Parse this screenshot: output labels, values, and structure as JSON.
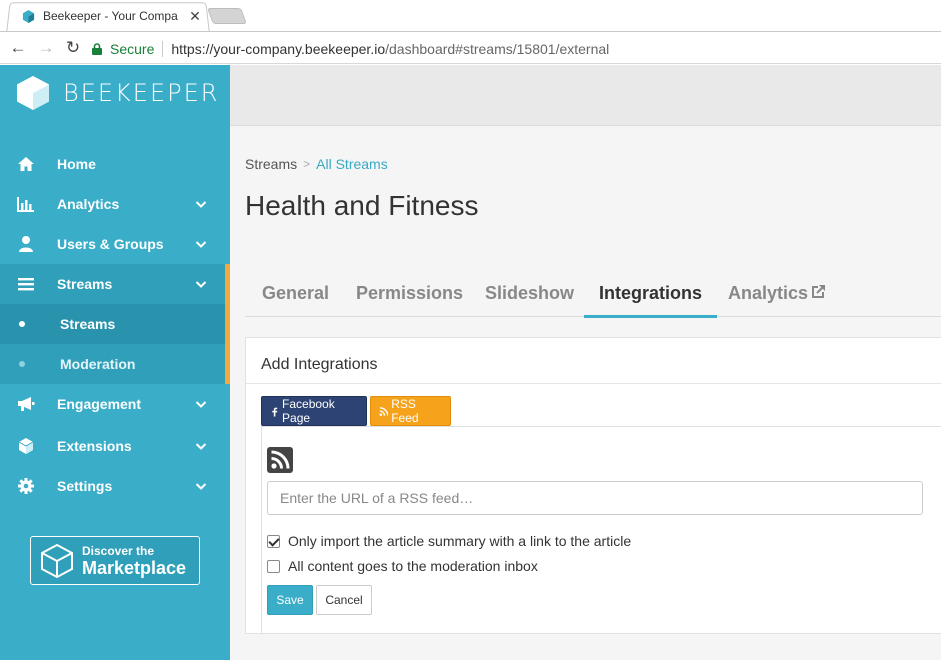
{
  "browser": {
    "tab_title": "Beekeeper - Your Compa",
    "close_glyph": "✕",
    "back_glyph": "←",
    "forward_glyph": "→",
    "reload_glyph": "↻",
    "secure_label": "Secure",
    "url_host": "https://your-company.beekeeper.io",
    "url_path": "/dashboard#streams/15801/external"
  },
  "brand": {
    "name": "BEEKEEPER"
  },
  "sidebar": {
    "items": [
      {
        "label": "Home",
        "icon": "home-icon"
      },
      {
        "label": "Analytics",
        "icon": "bar-chart-icon"
      },
      {
        "label": "Users & Groups",
        "icon": "user-icon"
      },
      {
        "label": "Streams",
        "icon": "list-icon"
      },
      {
        "label": "Engagement",
        "icon": "megaphone-icon"
      },
      {
        "label": "Extensions",
        "icon": "cube-icon"
      },
      {
        "label": "Settings",
        "icon": "gear-icon"
      }
    ],
    "sub_items": [
      {
        "label": "Streams"
      },
      {
        "label": "Moderation"
      }
    ],
    "marketplace": {
      "line1": "Discover the",
      "line2": "Marketplace"
    }
  },
  "breadcrumb": {
    "root": "Streams",
    "separator": ">",
    "link": "All Streams"
  },
  "page_title": "Health and Fitness",
  "tabs": [
    {
      "label": "General"
    },
    {
      "label": "Permissions"
    },
    {
      "label": "Slideshow"
    },
    {
      "label": "Integrations"
    },
    {
      "label": "Analytics"
    }
  ],
  "integrations": {
    "heading": "Add Integrations",
    "facebook_label": "Facebook Page",
    "rss_label": "RSS Feed",
    "url_placeholder": "Enter the URL of a RSS feed…",
    "summary_option": {
      "label": "Only import the article summary with a link to the article",
      "checked": true
    },
    "moderation_option": {
      "label": "All content goes to the moderation inbox",
      "checked": false
    },
    "save_label": "Save",
    "cancel_label": "Cancel"
  },
  "colors": {
    "sidebar": "#3aadc8",
    "accent_bar": "#f2a93b",
    "facebook": "#2d4373",
    "rss": "#f7a21b"
  }
}
